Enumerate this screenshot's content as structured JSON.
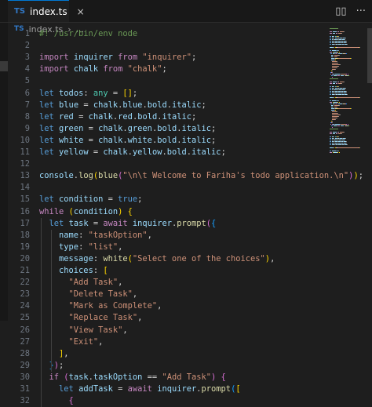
{
  "tab": {
    "lang_badge": "TS",
    "filename": "index.ts",
    "close_glyph": "×"
  },
  "top_actions": {
    "split_glyph": "▯▯",
    "more_glyph": "···"
  },
  "breadcrumb": {
    "lang_badge": "TS",
    "file": "index.ts",
    "separator": "›",
    "rest": "..."
  },
  "colors": {
    "comment": "#6a9955",
    "keyword": "#c586c0",
    "declaration": "#569cd6",
    "variable": "#9cdcfe",
    "string": "#ce9178",
    "function": "#dcdcaa",
    "type": "#4ec9b0",
    "text": "#d4d4d4",
    "accent": "#0078d4",
    "ts_blue": "#3178c6"
  },
  "lines": [
    {
      "n": "1",
      "tokens": [
        [
          "c-comment",
          "#! /usr/bin/env node"
        ]
      ]
    },
    {
      "n": "2",
      "tokens": []
    },
    {
      "n": "3",
      "tokens": [
        [
          "c-kw",
          "import"
        ],
        [
          "c-punct",
          " "
        ],
        [
          "c-var",
          "inquirer"
        ],
        [
          "c-punct",
          " "
        ],
        [
          "c-kw",
          "from"
        ],
        [
          "c-punct",
          " "
        ],
        [
          "c-str",
          "\"inquirer\""
        ],
        [
          "c-punct",
          ";"
        ]
      ]
    },
    {
      "n": "4",
      "tokens": [
        [
          "c-kw",
          "import"
        ],
        [
          "c-punct",
          " "
        ],
        [
          "c-var",
          "chalk"
        ],
        [
          "c-punct",
          " "
        ],
        [
          "c-kw",
          "from"
        ],
        [
          "c-punct",
          " "
        ],
        [
          "c-str",
          "\"chalk\""
        ],
        [
          "c-punct",
          ";"
        ]
      ]
    },
    {
      "n": "5",
      "tokens": []
    },
    {
      "n": "6",
      "tokens": [
        [
          "c-decl",
          "let"
        ],
        [
          "c-punct",
          " "
        ],
        [
          "c-var",
          "todos"
        ],
        [
          "c-punct",
          ": "
        ],
        [
          "c-type",
          "any"
        ],
        [
          "c-punct",
          " = "
        ],
        [
          "c-br1",
          "[]"
        ],
        [
          "c-punct",
          ";"
        ]
      ]
    },
    {
      "n": "7",
      "tokens": [
        [
          "c-decl",
          "let"
        ],
        [
          "c-punct",
          " "
        ],
        [
          "c-var",
          "blue"
        ],
        [
          "c-punct",
          " = "
        ],
        [
          "c-var",
          "chalk"
        ],
        [
          "c-punct",
          "."
        ],
        [
          "c-var",
          "blue"
        ],
        [
          "c-punct",
          "."
        ],
        [
          "c-var",
          "bold"
        ],
        [
          "c-punct",
          "."
        ],
        [
          "c-var",
          "italic"
        ],
        [
          "c-punct",
          ";"
        ]
      ]
    },
    {
      "n": "8",
      "tokens": [
        [
          "c-decl",
          "let"
        ],
        [
          "c-punct",
          " "
        ],
        [
          "c-var",
          "red"
        ],
        [
          "c-punct",
          " = "
        ],
        [
          "c-var",
          "chalk"
        ],
        [
          "c-punct",
          "."
        ],
        [
          "c-var",
          "red"
        ],
        [
          "c-punct",
          "."
        ],
        [
          "c-var",
          "bold"
        ],
        [
          "c-punct",
          "."
        ],
        [
          "c-var",
          "italic"
        ],
        [
          "c-punct",
          ";"
        ]
      ]
    },
    {
      "n": "9",
      "tokens": [
        [
          "c-decl",
          "let"
        ],
        [
          "c-punct",
          " "
        ],
        [
          "c-var",
          "green"
        ],
        [
          "c-punct",
          " = "
        ],
        [
          "c-var",
          "chalk"
        ],
        [
          "c-punct",
          "."
        ],
        [
          "c-var",
          "green"
        ],
        [
          "c-punct",
          "."
        ],
        [
          "c-var",
          "bold"
        ],
        [
          "c-punct",
          "."
        ],
        [
          "c-var",
          "italic"
        ],
        [
          "c-punct",
          ";"
        ]
      ]
    },
    {
      "n": "10",
      "tokens": [
        [
          "c-decl",
          "let"
        ],
        [
          "c-punct",
          " "
        ],
        [
          "c-var",
          "white"
        ],
        [
          "c-punct",
          " = "
        ],
        [
          "c-var",
          "chalk"
        ],
        [
          "c-punct",
          "."
        ],
        [
          "c-var",
          "white"
        ],
        [
          "c-punct",
          "."
        ],
        [
          "c-var",
          "bold"
        ],
        [
          "c-punct",
          "."
        ],
        [
          "c-var",
          "italic"
        ],
        [
          "c-punct",
          ";"
        ]
      ]
    },
    {
      "n": "11",
      "tokens": [
        [
          "c-decl",
          "let"
        ],
        [
          "c-punct",
          " "
        ],
        [
          "c-var",
          "yellow"
        ],
        [
          "c-punct",
          " = "
        ],
        [
          "c-var",
          "chalk"
        ],
        [
          "c-punct",
          "."
        ],
        [
          "c-var",
          "yellow"
        ],
        [
          "c-punct",
          "."
        ],
        [
          "c-var",
          "bold"
        ],
        [
          "c-punct",
          "."
        ],
        [
          "c-var",
          "italic"
        ],
        [
          "c-punct",
          ";"
        ]
      ]
    },
    {
      "n": "12",
      "tokens": []
    },
    {
      "n": "13",
      "tokens": [
        [
          "c-var",
          "console"
        ],
        [
          "c-punct",
          "."
        ],
        [
          "c-fn",
          "log"
        ],
        [
          "c-br1",
          "("
        ],
        [
          "c-fn",
          "blue"
        ],
        [
          "c-br2",
          "("
        ],
        [
          "c-str",
          "\"\\n\\t Welcome to Fariha's todo application.\\n\""
        ],
        [
          "c-br2",
          ")"
        ],
        [
          "c-br1",
          ")"
        ],
        [
          "c-punct",
          ";"
        ]
      ]
    },
    {
      "n": "14",
      "tokens": []
    },
    {
      "n": "15",
      "tokens": [
        [
          "c-decl",
          "let"
        ],
        [
          "c-punct",
          " "
        ],
        [
          "c-var",
          "condition"
        ],
        [
          "c-punct",
          " = "
        ],
        [
          "c-decl",
          "true"
        ],
        [
          "c-punct",
          ";"
        ]
      ]
    },
    {
      "n": "16",
      "tokens": [
        [
          "c-kw",
          "while"
        ],
        [
          "c-punct",
          " "
        ],
        [
          "c-br1",
          "("
        ],
        [
          "c-var",
          "condition"
        ],
        [
          "c-br1",
          ")"
        ],
        [
          "c-punct",
          " "
        ],
        [
          "c-br1",
          "{"
        ]
      ]
    },
    {
      "n": "17",
      "tokens": [
        [
          "c-punct",
          "  "
        ],
        [
          "c-decl",
          "let"
        ],
        [
          "c-punct",
          " "
        ],
        [
          "c-var",
          "task"
        ],
        [
          "c-punct",
          " = "
        ],
        [
          "c-kw",
          "await"
        ],
        [
          "c-punct",
          " "
        ],
        [
          "c-var",
          "inquirer"
        ],
        [
          "c-punct",
          "."
        ],
        [
          "c-fn",
          "prompt"
        ],
        [
          "c-br2",
          "("
        ],
        [
          "c-br3",
          "{"
        ]
      ]
    },
    {
      "n": "18",
      "tokens": [
        [
          "c-punct",
          "    "
        ],
        [
          "c-var",
          "name"
        ],
        [
          "c-punct",
          ": "
        ],
        [
          "c-str",
          "\"taskOption\""
        ],
        [
          "c-punct",
          ","
        ]
      ]
    },
    {
      "n": "19",
      "tokens": [
        [
          "c-punct",
          "    "
        ],
        [
          "c-var",
          "type"
        ],
        [
          "c-punct",
          ": "
        ],
        [
          "c-str",
          "\"list\""
        ],
        [
          "c-punct",
          ","
        ]
      ]
    },
    {
      "n": "20",
      "tokens": [
        [
          "c-punct",
          "    "
        ],
        [
          "c-var",
          "message"
        ],
        [
          "c-punct",
          ": "
        ],
        [
          "c-fn",
          "white"
        ],
        [
          "c-br1",
          "("
        ],
        [
          "c-str",
          "\"Select one of the choices\""
        ],
        [
          "c-br1",
          ")"
        ],
        [
          "c-punct",
          ","
        ]
      ]
    },
    {
      "n": "21",
      "tokens": [
        [
          "c-punct",
          "    "
        ],
        [
          "c-var",
          "choices"
        ],
        [
          "c-punct",
          ": "
        ],
        [
          "c-br1",
          "["
        ]
      ]
    },
    {
      "n": "22",
      "tokens": [
        [
          "c-punct",
          "      "
        ],
        [
          "c-str",
          "\"Add Task\""
        ],
        [
          "c-punct",
          ","
        ]
      ]
    },
    {
      "n": "23",
      "tokens": [
        [
          "c-punct",
          "      "
        ],
        [
          "c-str",
          "\"Delete Task\""
        ],
        [
          "c-punct",
          ","
        ]
      ]
    },
    {
      "n": "24",
      "tokens": [
        [
          "c-punct",
          "      "
        ],
        [
          "c-str",
          "\"Mark as Complete\""
        ],
        [
          "c-punct",
          ","
        ]
      ]
    },
    {
      "n": "25",
      "tokens": [
        [
          "c-punct",
          "      "
        ],
        [
          "c-str",
          "\"Replace Task\""
        ],
        [
          "c-punct",
          ","
        ]
      ]
    },
    {
      "n": "26",
      "tokens": [
        [
          "c-punct",
          "      "
        ],
        [
          "c-str",
          "\"View Task\""
        ],
        [
          "c-punct",
          ","
        ]
      ]
    },
    {
      "n": "27",
      "tokens": [
        [
          "c-punct",
          "      "
        ],
        [
          "c-str",
          "\"Exit\""
        ],
        [
          "c-punct",
          ","
        ]
      ]
    },
    {
      "n": "28",
      "tokens": [
        [
          "c-punct",
          "    "
        ],
        [
          "c-br1",
          "]"
        ],
        [
          "c-punct",
          ","
        ]
      ]
    },
    {
      "n": "29",
      "tokens": [
        [
          "c-punct",
          "  "
        ],
        [
          "c-br3",
          "}"
        ],
        [
          "c-br2",
          ")"
        ],
        [
          "c-punct",
          ";"
        ]
      ]
    },
    {
      "n": "30",
      "tokens": [
        [
          "c-punct",
          "  "
        ],
        [
          "c-kw",
          "if"
        ],
        [
          "c-punct",
          " "
        ],
        [
          "c-br2",
          "("
        ],
        [
          "c-var",
          "task"
        ],
        [
          "c-punct",
          "."
        ],
        [
          "c-var",
          "taskOption"
        ],
        [
          "c-punct",
          " == "
        ],
        [
          "c-str",
          "\"Add Task\""
        ],
        [
          "c-br2",
          ")"
        ],
        [
          "c-punct",
          " "
        ],
        [
          "c-br2",
          "{"
        ]
      ]
    },
    {
      "n": "31",
      "tokens": [
        [
          "c-punct",
          "    "
        ],
        [
          "c-decl",
          "let"
        ],
        [
          "c-punct",
          " "
        ],
        [
          "c-var",
          "addTask"
        ],
        [
          "c-punct",
          " = "
        ],
        [
          "c-kw",
          "await"
        ],
        [
          "c-punct",
          " "
        ],
        [
          "c-var",
          "inquirer"
        ],
        [
          "c-punct",
          "."
        ],
        [
          "c-fn",
          "prompt"
        ],
        [
          "c-br3",
          "("
        ],
        [
          "c-br1",
          "["
        ]
      ]
    },
    {
      "n": "32",
      "tokens": [
        [
          "c-punct",
          "      "
        ],
        [
          "c-br2",
          "{"
        ]
      ]
    }
  ]
}
